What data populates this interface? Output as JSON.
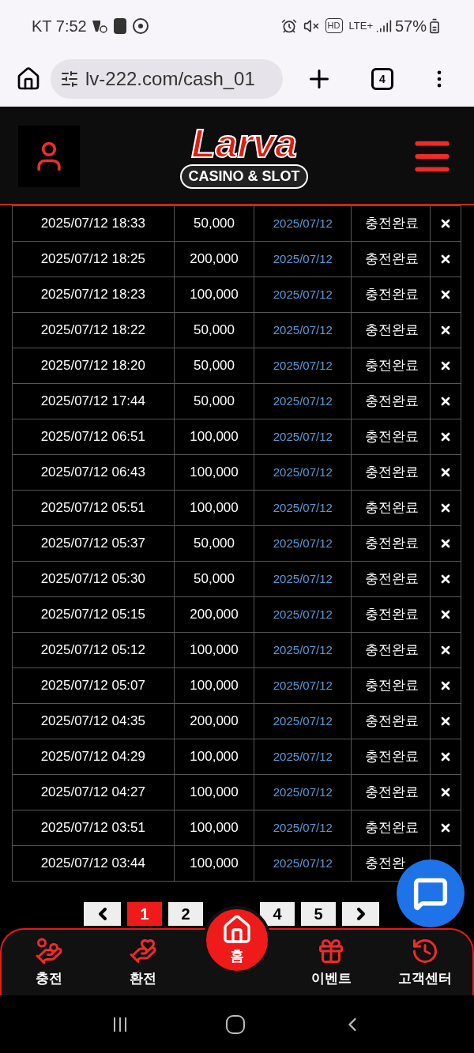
{
  "status_bar": {
    "carrier_time": "KT 7:52",
    "indicators": [
      "HD",
      "LTE+"
    ],
    "battery": "57%"
  },
  "browser": {
    "url": "lv-222.com/cash_01",
    "tab_count": "4"
  },
  "header": {
    "logo": {
      "title": "Larva",
      "subtitle": "CASINO & SLOT"
    }
  },
  "table": {
    "rows": [
      {
        "datetime": "2025/07/12 18:33",
        "amount": "50,000",
        "date": "2025/07/12",
        "status": "충전완료",
        "has_delete": true
      },
      {
        "datetime": "2025/07/12 18:25",
        "amount": "200,000",
        "date": "2025/07/12",
        "status": "충전완료",
        "has_delete": true
      },
      {
        "datetime": "2025/07/12 18:23",
        "amount": "100,000",
        "date": "2025/07/12",
        "status": "충전완료",
        "has_delete": true
      },
      {
        "datetime": "2025/07/12 18:22",
        "amount": "50,000",
        "date": "2025/07/12",
        "status": "충전완료",
        "has_delete": true
      },
      {
        "datetime": "2025/07/12 18:20",
        "amount": "50,000",
        "date": "2025/07/12",
        "status": "충전완료",
        "has_delete": true
      },
      {
        "datetime": "2025/07/12 17:44",
        "amount": "50,000",
        "date": "2025/07/12",
        "status": "충전완료",
        "has_delete": true
      },
      {
        "datetime": "2025/07/12 06:51",
        "amount": "100,000",
        "date": "2025/07/12",
        "status": "충전완료",
        "has_delete": true
      },
      {
        "datetime": "2025/07/12 06:43",
        "amount": "100,000",
        "date": "2025/07/12",
        "status": "충전완료",
        "has_delete": true
      },
      {
        "datetime": "2025/07/12 05:51",
        "amount": "100,000",
        "date": "2025/07/12",
        "status": "충전완료",
        "has_delete": true
      },
      {
        "datetime": "2025/07/12 05:37",
        "amount": "50,000",
        "date": "2025/07/12",
        "status": "충전완료",
        "has_delete": true
      },
      {
        "datetime": "2025/07/12 05:30",
        "amount": "50,000",
        "date": "2025/07/12",
        "status": "충전완료",
        "has_delete": true
      },
      {
        "datetime": "2025/07/12 05:15",
        "amount": "200,000",
        "date": "2025/07/12",
        "status": "충전완료",
        "has_delete": true
      },
      {
        "datetime": "2025/07/12 05:12",
        "amount": "100,000",
        "date": "2025/07/12",
        "status": "충전완료",
        "has_delete": true
      },
      {
        "datetime": "2025/07/12 05:07",
        "amount": "100,000",
        "date": "2025/07/12",
        "status": "충전완료",
        "has_delete": true
      },
      {
        "datetime": "2025/07/12 04:35",
        "amount": "200,000",
        "date": "2025/07/12",
        "status": "충전완료",
        "has_delete": true
      },
      {
        "datetime": "2025/07/12 04:29",
        "amount": "100,000",
        "date": "2025/07/12",
        "status": "충전완료",
        "has_delete": true
      },
      {
        "datetime": "2025/07/12 04:27",
        "amount": "100,000",
        "date": "2025/07/12",
        "status": "충전완료",
        "has_delete": true
      },
      {
        "datetime": "2025/07/12 03:51",
        "amount": "100,000",
        "date": "2025/07/12",
        "status": "충전완료",
        "has_delete": true
      },
      {
        "datetime": "2025/07/12 03:44",
        "amount": "100,000",
        "date": "2025/07/12",
        "status": "충전완",
        "has_delete": false
      }
    ]
  },
  "pagination": {
    "pages": [
      {
        "label": "1",
        "selected": true
      },
      {
        "label": "2",
        "selected": false
      },
      {
        "label": "4",
        "selected": false
      },
      {
        "label": "5",
        "selected": false
      }
    ]
  },
  "bottom_nav": [
    {
      "kind": "deposit",
      "label": "충전"
    },
    {
      "kind": "withdraw",
      "label": "환전"
    },
    {
      "kind": "home",
      "label": "홈"
    },
    {
      "kind": "event",
      "label": "이벤트"
    },
    {
      "kind": "support",
      "label": "고객센터"
    }
  ]
}
